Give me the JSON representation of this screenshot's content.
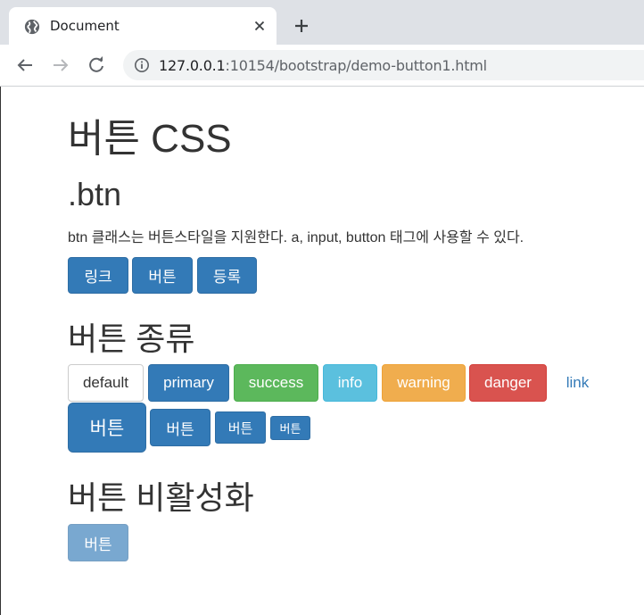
{
  "browser": {
    "tab_title": "Document",
    "url_host": "127.0.0.1",
    "url_rest": ":10154/bootstrap/demo-button1.html"
  },
  "page": {
    "title": "버튼 CSS",
    "section1": {
      "heading": ".btn",
      "description": "btn 클래스는 버튼스타일을 지원한다. a, input, button 태그에 사용할 수 있다.",
      "buttons": [
        "링크",
        "버튼",
        "등록"
      ]
    },
    "section2": {
      "heading": "버튼 종류",
      "variants": [
        "default",
        "primary",
        "success",
        "info",
        "warning",
        "danger",
        "link"
      ],
      "sizes": [
        "버튼",
        "버튼",
        "버튼",
        "버튼"
      ]
    },
    "section3": {
      "heading": "버튼 비활성화",
      "disabled_button": "버튼"
    }
  },
  "colors": {
    "primary": "#337ab7",
    "success": "#5cb85c",
    "info": "#5bc0de",
    "warning": "#f0ad4e",
    "danger": "#d9534f"
  }
}
